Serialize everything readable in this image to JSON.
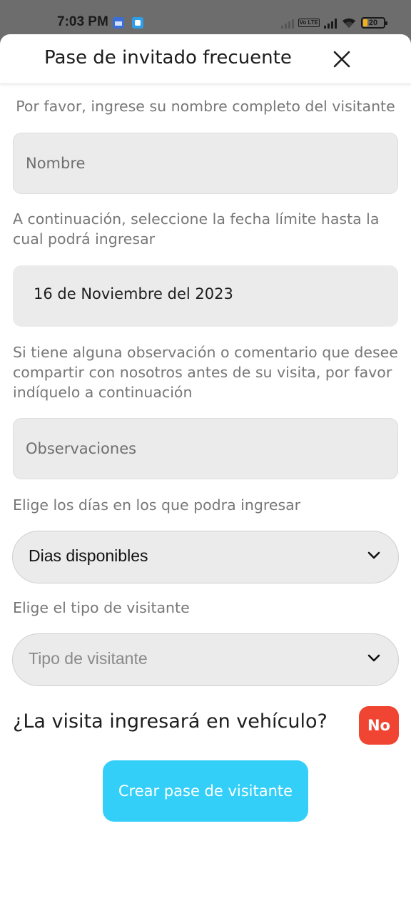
{
  "status_bar": {
    "time": "7:03 PM",
    "battery": "20",
    "volte": "Vo LTE",
    "icons": [
      "calendar-app-icon",
      "app-notification-icon",
      "signal-icon",
      "volte-icon",
      "wifi-icon",
      "battery-icon"
    ]
  },
  "header": {
    "title": "Pase de invitado frecuente",
    "close_icon": "close-icon"
  },
  "form": {
    "name_instruction": "Por favor, ingrese su nombre completo del visitante",
    "name_placeholder": "Nombre",
    "date_instruction": "A continuación, seleccione la fecha límite hasta la cual podrá ingresar",
    "date_value": "16 de Noviembre del 2023",
    "observations_instruction": "Si tiene alguna observación o comentario que desee compartir con nosotros antes de su visita, por favor indíquelo a continuación",
    "observations_placeholder": "Observaciones",
    "days_instruction": "Elige los días en los que podra ingresar",
    "days_select": "Dias disponibles",
    "visitor_type_instruction": "Elige el tipo de visitante",
    "visitor_type_select": "Tipo de visitante",
    "vehicle_question": "¿La visita ingresará en vehículo?",
    "vehicle_toggle": "No",
    "submit_label": "Crear pase de visitante"
  },
  "colors": {
    "accent_button": "#33cff8",
    "toggle_no": "#f04532",
    "field_bg": "#ebebeb"
  }
}
